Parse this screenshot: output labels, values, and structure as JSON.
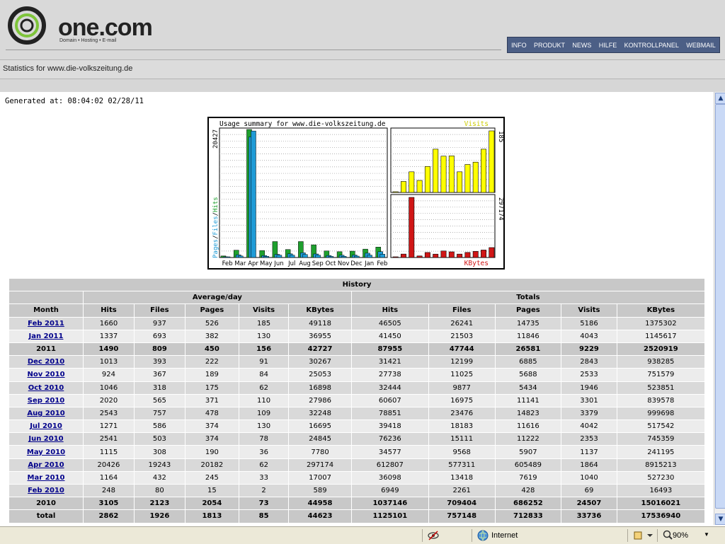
{
  "logo": {
    "name": "one.com",
    "tagline": "Domain • Hosting • E-mail"
  },
  "topnav": {
    "items": [
      "INFO",
      "PRODUKT",
      "NEWS",
      "HILFE",
      "KONTROLLPANEL",
      "WEBMAIL"
    ]
  },
  "page": {
    "title": "Statistics for www.die-volkszeitung.de",
    "generated": "Generated at: 08:04:02 02/28/11"
  },
  "colors": {
    "hits": "#1ea02e",
    "files": "#1f9bd6",
    "pages": "#1f9bd6",
    "visits": "#ffff00",
    "kbytes": "#d01616",
    "nav_bg": "#4c5f86",
    "header_bg": "#d9d9d9",
    "link": "#00008b"
  },
  "chart_data": {
    "type": "bar",
    "title": "Usage summary for www.die-volkszeitung.de",
    "categories": [
      "Feb",
      "Mar",
      "Apr",
      "May",
      "Jun",
      "Jul",
      "Aug",
      "Sep",
      "Oct",
      "Nov",
      "Dec",
      "Jan",
      "Feb"
    ],
    "left_panel": {
      "axis_label": "Pages/Files/Hits",
      "axis_label_parts": [
        "Pages",
        "Files",
        "Hits"
      ],
      "max_label": "20427",
      "ymax": 20427,
      "series": [
        {
          "name": "Hits",
          "values": [
            248,
            1164,
            20426,
            1115,
            2541,
            1271,
            2543,
            2020,
            1046,
            924,
            1013,
            1337,
            1660
          ]
        },
        {
          "name": "Files",
          "values": [
            80,
            432,
            19243,
            308,
            503,
            586,
            757,
            565,
            318,
            367,
            393,
            693,
            937
          ]
        },
        {
          "name": "Pages",
          "values": [
            15,
            245,
            20182,
            190,
            374,
            374,
            478,
            371,
            175,
            189,
            222,
            382,
            526
          ]
        }
      ]
    },
    "visits_panel": {
      "title": "Visits",
      "max_label": "185",
      "ymax": 185,
      "values": [
        2,
        33,
        62,
        36,
        78,
        130,
        109,
        110,
        62,
        84,
        91,
        130,
        185
      ]
    },
    "kbytes_panel": {
      "title": "KBytes",
      "max_label": "297174",
      "ymax": 297174,
      "values": [
        589,
        17007,
        297174,
        7780,
        24845,
        16695,
        32248,
        27986,
        16898,
        25053,
        30267,
        36955,
        49118
      ]
    }
  },
  "table": {
    "caption": "History",
    "group_headers": [
      "Average/day",
      "Totals"
    ],
    "columns": [
      "Month",
      "Hits",
      "Files",
      "Pages",
      "Visits",
      "KBytes",
      "Hits",
      "Files",
      "Pages",
      "Visits",
      "KBytes"
    ],
    "rows": [
      {
        "month": "Feb 2011",
        "link": true,
        "style": "data",
        "cells": [
          "1660",
          "937",
          "526",
          "185",
          "49118",
          "46505",
          "26241",
          "14735",
          "5186",
          "1375302"
        ]
      },
      {
        "month": "Jan 2011",
        "link": true,
        "style": "alt",
        "cells": [
          "1337",
          "693",
          "382",
          "130",
          "36955",
          "41450",
          "21503",
          "11846",
          "4043",
          "1145617"
        ]
      },
      {
        "month": "2011",
        "link": false,
        "style": "year",
        "cells": [
          "1490",
          "809",
          "450",
          "156",
          "42727",
          "87955",
          "47744",
          "26581",
          "9229",
          "2520919"
        ]
      },
      {
        "month": "Dec 2010",
        "link": true,
        "style": "data",
        "cells": [
          "1013",
          "393",
          "222",
          "91",
          "30267",
          "31421",
          "12199",
          "6885",
          "2843",
          "938285"
        ]
      },
      {
        "month": "Nov 2010",
        "link": true,
        "style": "alt",
        "cells": [
          "924",
          "367",
          "189",
          "84",
          "25053",
          "27738",
          "11025",
          "5688",
          "2533",
          "751579"
        ]
      },
      {
        "month": "Oct 2010",
        "link": true,
        "style": "data",
        "cells": [
          "1046",
          "318",
          "175",
          "62",
          "16898",
          "32444",
          "9877",
          "5434",
          "1946",
          "523851"
        ]
      },
      {
        "month": "Sep 2010",
        "link": true,
        "style": "alt",
        "cells": [
          "2020",
          "565",
          "371",
          "110",
          "27986",
          "60607",
          "16975",
          "11141",
          "3301",
          "839578"
        ]
      },
      {
        "month": "Aug 2010",
        "link": true,
        "style": "data",
        "cells": [
          "2543",
          "757",
          "478",
          "109",
          "32248",
          "78851",
          "23476",
          "14823",
          "3379",
          "999698"
        ]
      },
      {
        "month": "Jul 2010",
        "link": true,
        "style": "alt",
        "cells": [
          "1271",
          "586",
          "374",
          "130",
          "16695",
          "39418",
          "18183",
          "11616",
          "4042",
          "517542"
        ]
      },
      {
        "month": "Jun 2010",
        "link": true,
        "style": "data",
        "cells": [
          "2541",
          "503",
          "374",
          "78",
          "24845",
          "76236",
          "15111",
          "11222",
          "2353",
          "745359"
        ]
      },
      {
        "month": "May 2010",
        "link": true,
        "style": "alt",
        "cells": [
          "1115",
          "308",
          "190",
          "36",
          "7780",
          "34577",
          "9568",
          "5907",
          "1137",
          "241195"
        ]
      },
      {
        "month": "Apr 2010",
        "link": true,
        "style": "data",
        "cells": [
          "20426",
          "19243",
          "20182",
          "62",
          "297174",
          "612807",
          "577311",
          "605489",
          "1864",
          "8915213"
        ]
      },
      {
        "month": "Mar 2010",
        "link": true,
        "style": "alt",
        "cells": [
          "1164",
          "432",
          "245",
          "33",
          "17007",
          "36098",
          "13418",
          "7619",
          "1040",
          "527230"
        ]
      },
      {
        "month": "Feb 2010",
        "link": true,
        "style": "data",
        "cells": [
          "248",
          "80",
          "15",
          "2",
          "589",
          "6949",
          "2261",
          "428",
          "69",
          "16493"
        ]
      },
      {
        "month": "2010",
        "link": false,
        "style": "year",
        "cells": [
          "3105",
          "2123",
          "2054",
          "73",
          "44958",
          "1037146",
          "709404",
          "686252",
          "24507",
          "15016021"
        ]
      },
      {
        "month": "total",
        "link": false,
        "style": "year",
        "cells": [
          "2862",
          "1926",
          "1813",
          "85",
          "44623",
          "1125101",
          "757148",
          "712833",
          "33736",
          "17536940"
        ]
      }
    ]
  },
  "statusbar": {
    "zone": "Internet",
    "zoom": "90%",
    "icons": [
      "privacy-icon",
      "globe-icon",
      "protected-mode-icon",
      "zoom-icon"
    ]
  }
}
